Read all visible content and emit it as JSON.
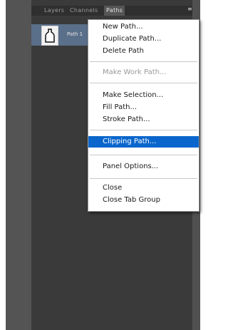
{
  "tabs": [
    {
      "label": "Layers",
      "active": false
    },
    {
      "label": "Channels",
      "active": false
    },
    {
      "label": "Paths",
      "active": true
    }
  ],
  "panel_menu_icon": "panel-options-icon",
  "path_item": {
    "name": "Path 1",
    "thumbnail_icon": "bottle-shape-icon"
  },
  "menu": {
    "items": [
      {
        "label": "New Path...",
        "enabled": true,
        "highlighted": false
      },
      {
        "label": "Duplicate Path...",
        "enabled": true,
        "highlighted": false
      },
      {
        "label": "Delete Path",
        "enabled": true,
        "highlighted": false
      },
      {
        "label": "Make Work Path...",
        "enabled": false,
        "highlighted": false
      },
      {
        "label": "Make Selection...",
        "enabled": true,
        "highlighted": false
      },
      {
        "label": "Fill Path...",
        "enabled": true,
        "highlighted": false
      },
      {
        "label": "Stroke Path...",
        "enabled": true,
        "highlighted": false
      },
      {
        "label": "Clipping Path...",
        "enabled": true,
        "highlighted": true
      },
      {
        "label": "Panel Options...",
        "enabled": true,
        "highlighted": false
      },
      {
        "label": "Close",
        "enabled": true,
        "highlighted": false
      },
      {
        "label": "Close Tab Group",
        "enabled": true,
        "highlighted": false
      }
    ]
  },
  "colors": {
    "highlight": "#0a66cc",
    "selected_row": "#5a6f8a",
    "panel_bg": "#3a3a3a"
  }
}
